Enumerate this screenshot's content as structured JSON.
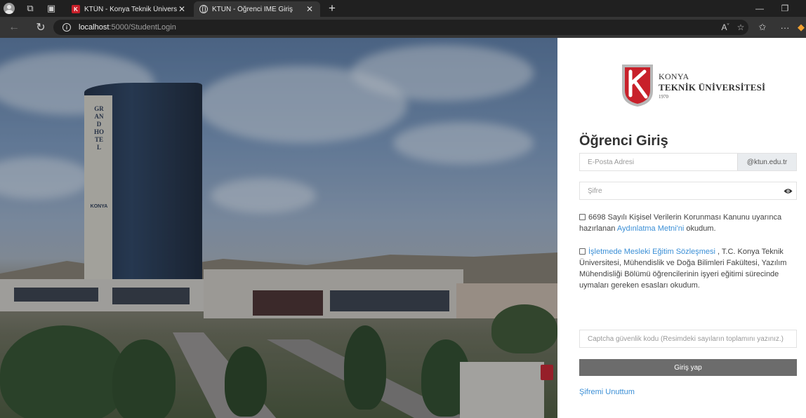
{
  "browser": {
    "tabs": [
      {
        "title": "KTÜN - Konya Teknik Üniversitesi",
        "active": false,
        "icon": "ktun-favicon"
      },
      {
        "title": "KTUN - Öğrenci İME Giriş",
        "active": true,
        "icon": "globe-icon"
      }
    ],
    "url_host": "localhost",
    "url_rest": ":5000/StudentLogin",
    "read_aloud": "A̅"
  },
  "logo": {
    "line1": "KONYA",
    "line2": "TEKNİK ÜNİVERSİTESİ",
    "line3": "1970",
    "colors": {
      "red": "#c8202a",
      "grey": "#b8b8b8"
    }
  },
  "tower_sign": "GRAND HOTEL",
  "tower_sign2": "KONYA",
  "login": {
    "title": "Öğrenci Giriş",
    "email_placeholder": "E-Posta Adresi",
    "email_domain": "@ktun.edu.tr",
    "password_placeholder": "Şifre",
    "kvkk_text_before": "6698 Sayılı Kişisel Verilerin Korunması Kanunu uyarınca hazırlanan ",
    "kvkk_link": "Aydınlatma Metni'ni",
    "kvkk_text_after": " okudum.",
    "contract_link": "İşletmede Mesleki Eğitim Sözleşmesi",
    "contract_text": " , T.C. Konya Teknik Üniversitesi, Mühendislik ve Doğa Bilimleri Fakültesi, Yazılım Mühendisliği Bölümü öğrencilerinin işyeri eğitimi sürecinde uymaları gereken esasları okudum.",
    "captcha_placeholder": "Captcha güvenlik kodu (Resimdeki sayıların toplamını yazınız.)",
    "submit_label": "Giriş yap",
    "forgot_label": "Şifremi Unuttum"
  },
  "colors": {
    "link": "#3b8fd6",
    "button": "#6c6c6c",
    "brand_red": "#c8202a"
  }
}
